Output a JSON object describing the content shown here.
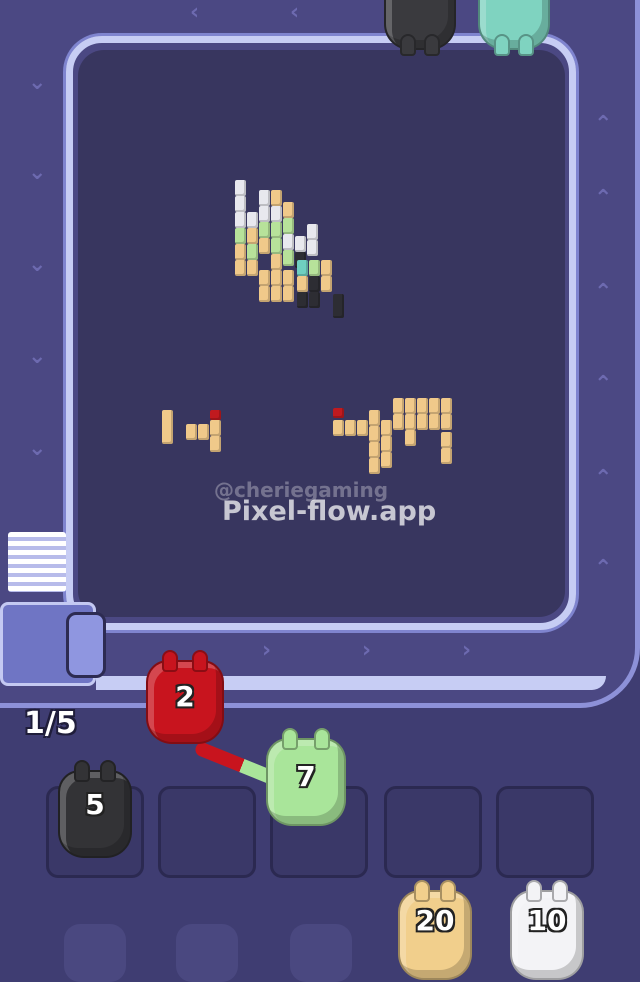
{
  "game": {
    "conveyor_counter": "1/5",
    "watermark_handle": "@cheriegaming",
    "watermark_site": "Pixel-flow.app"
  },
  "pigs": {
    "top_black": {
      "color": "#3a3a3e"
    },
    "top_teal": {
      "color": "#7fd3c0"
    },
    "red": {
      "count": "2",
      "color": "#c8141e"
    },
    "green": {
      "count": "7",
      "color": "#a9e59a"
    },
    "black": {
      "count": "5",
      "color": "#333336"
    },
    "tan": {
      "count": "20",
      "color": "#f1cf8c"
    },
    "white": {
      "count": "10",
      "color": "#f3f3f6"
    }
  },
  "slots": {
    "count": 5,
    "state": "empty"
  },
  "colors": {
    "background": "#3f3d72",
    "board": "#38365f",
    "rail": "#c7cdf4",
    "pixel_tan": "#f0c98a",
    "pixel_white": "#e8e8ee",
    "pixel_green": "#b7e29a",
    "pixel_black": "#2d2d33",
    "pixel_red": "#c01a1f",
    "pixel_teal": "#6fcfc0"
  }
}
